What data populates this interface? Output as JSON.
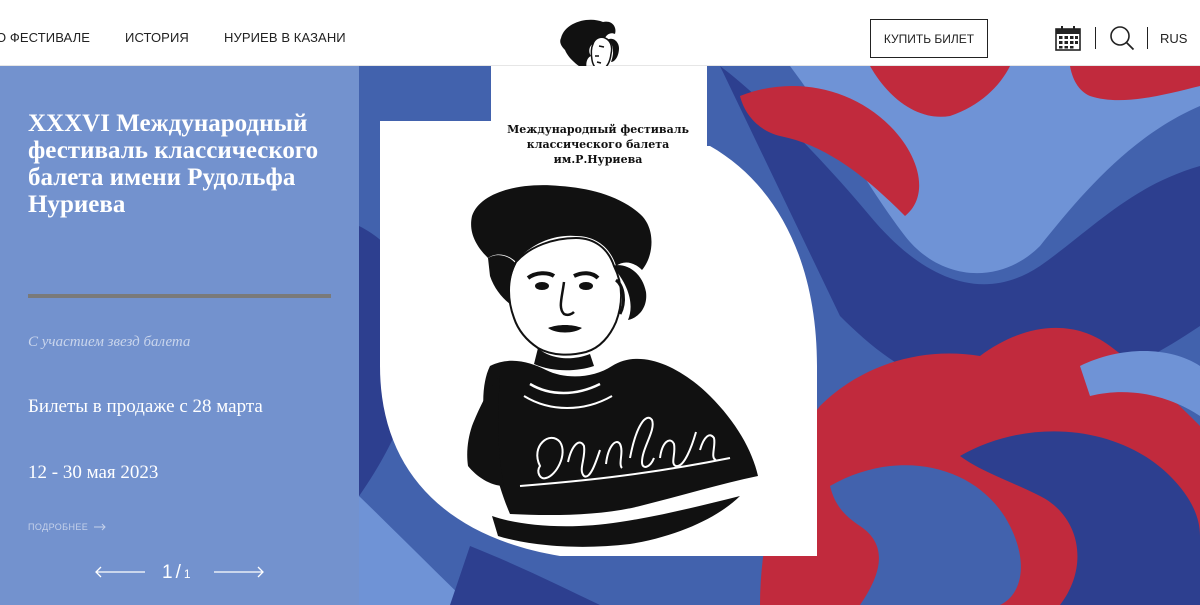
{
  "header": {
    "nav": [
      {
        "label": "О ФЕСТИВАЛЕ"
      },
      {
        "label": "ИСТОРИЯ"
      },
      {
        "label": "НУРИЕВ В КАЗАНИ"
      }
    ],
    "buy_button": "КУПИТЬ БИЛЕТ",
    "language": "RUS",
    "icons": [
      "calendar-icon",
      "search-icon"
    ]
  },
  "hero": {
    "title": "XXXVI Международный фестиваль классического балета имени Рудольфа Нуриева",
    "subtitle": "С участием звезд балета",
    "tickets": "Билеты в продаже с 28 марта",
    "dates": "12 - 30 мая 2023",
    "more_link": "ПОДРОБНЕЕ",
    "slider": {
      "current": "1",
      "separator": "/",
      "total": "1"
    }
  },
  "logo": {
    "caption": "Международный фестиваль классического балета им.Р.Нуриева"
  },
  "colors": {
    "blue": "#4262ad",
    "dark_blue": "#2d3f8f",
    "light_blue": "#6f93d6",
    "red": "#c12a3d",
    "panel": "#82a0d7"
  }
}
